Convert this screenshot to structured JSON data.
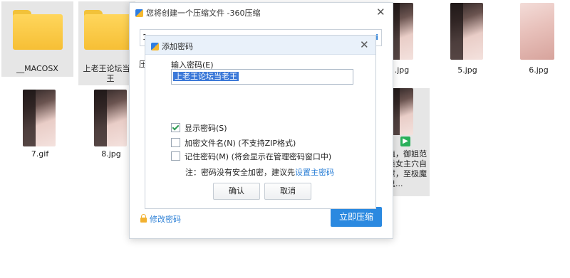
{
  "desktop": {
    "items": [
      {
        "label": "__MACOSX",
        "kind": "folder"
      },
      {
        "label": "上老王论坛当老王",
        "kind": "folder"
      },
      {
        "label": ".jpg",
        "kind": "image"
      },
      {
        "label": "5.jpg",
        "kind": "image"
      },
      {
        "label": "6.jpg",
        "kind": "image"
      },
      {
        "label": "7.gif",
        "kind": "image"
      },
      {
        "label": "8.jpg",
        "kind": "image"
      },
      {
        "label": "植，御姐范美女主穴自慰，至极魔鬼...",
        "kind": "video"
      }
    ]
  },
  "main_dialog": {
    "title": "您将创建一个压缩文件 -360压缩",
    "partial_field_char": "1",
    "partial_label": "压",
    "right_marker": "i",
    "modify_password_link": "修改密码",
    "compress_button": "立即压缩"
  },
  "password_dialog": {
    "title": "添加密码",
    "input_label": "输入密码(E)",
    "input_value": "上老王论坛当老王",
    "show_password": {
      "label": "显示密码(S)",
      "checked": true
    },
    "encrypt_filenames": {
      "label": "加密文件名(N) (不支持ZIP格式)",
      "checked": false
    },
    "remember_password": {
      "label": "记住密码(M) (将会显示在管理密码窗口中)",
      "checked": false
    },
    "note_prefix": "注：密码没有安全加密，建议先",
    "note_link": "设置主密码",
    "ok_button": "确认",
    "cancel_button": "取消"
  },
  "colors": {
    "primary": "#2b89e0",
    "link": "#2b7fd6",
    "header_bg": "#e9f1fa",
    "check": "#2e9b53"
  }
}
